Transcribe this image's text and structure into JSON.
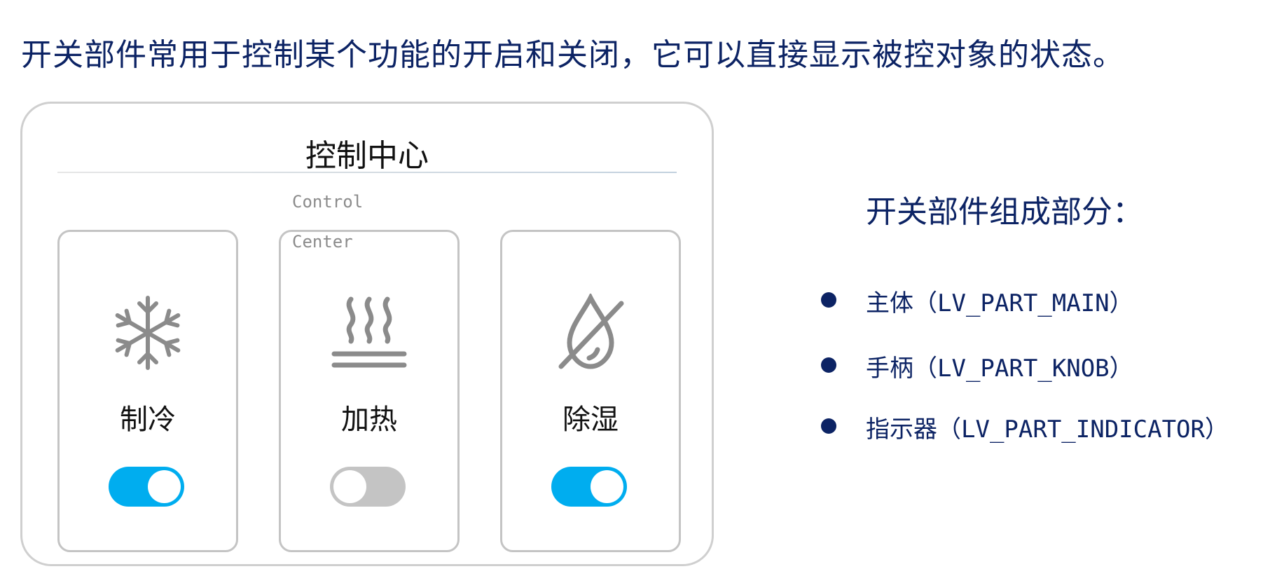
{
  "intro_text": "开关部件常用于控制某个功能的开启和关闭，它可以直接显示被控对象的状态。",
  "panel": {
    "title": "控制中心",
    "subtitle": "Control Center",
    "cards": [
      {
        "label": "制冷",
        "icon": "snowflake-icon",
        "switch_state": "on"
      },
      {
        "label": "加热",
        "icon": "heat-icon",
        "switch_state": "off"
      },
      {
        "label": "除湿",
        "icon": "no-water-drop-icon",
        "switch_state": "on"
      }
    ]
  },
  "parts": {
    "title": "开关部件组成部分：",
    "items": [
      "主体（LV_PART_MAIN）",
      "手柄（LV_PART_KNOB）",
      "指示器（LV_PART_INDICATOR）"
    ]
  },
  "colors": {
    "accent_on": "#00adef",
    "switch_off": "#c4c4c4",
    "text_blue": "#0c2364",
    "icon_gray": "#8b8b8b"
  }
}
